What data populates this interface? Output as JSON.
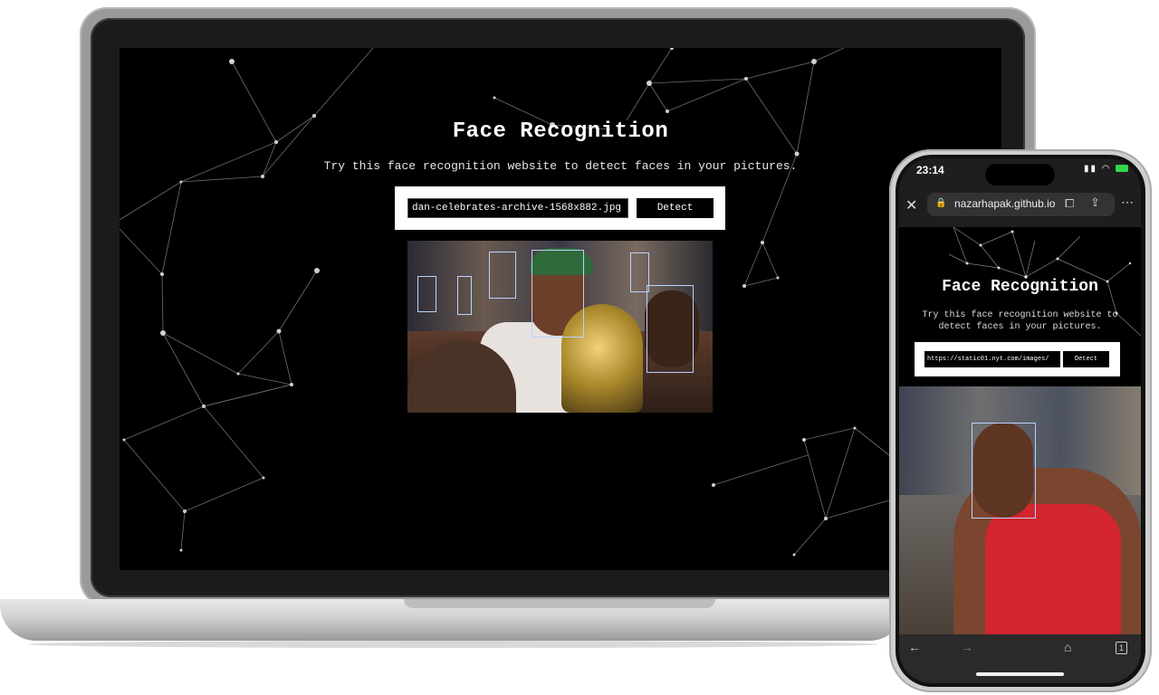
{
  "laptop": {
    "title": "Face Recognition",
    "subtitle": "Try this face recognition website to detect faces in your pictures.",
    "input_value": "dan-celebrates-archive-1568x882.jpg",
    "detect_label": "Detect"
  },
  "phone": {
    "status": {
      "time": "23:14"
    },
    "browser": {
      "url": "nazarhapak.github.io",
      "tab_count": "1"
    },
    "title": "Face Recognition",
    "subtitle": "Try this face recognition website to detect faces in your pictures.",
    "input_value": "https://static01.nyt.com/images/",
    "detect_label": "Detect"
  },
  "icons": {
    "close": "✕",
    "lock": "🔒",
    "bookmark": "⧠",
    "share": "⇪",
    "more": "⋯",
    "back": "←",
    "forward": "→",
    "home": "⌂"
  },
  "colors": {
    "face_box": "#b9d3ff",
    "background": "#000000",
    "battery": "#32d74b"
  }
}
